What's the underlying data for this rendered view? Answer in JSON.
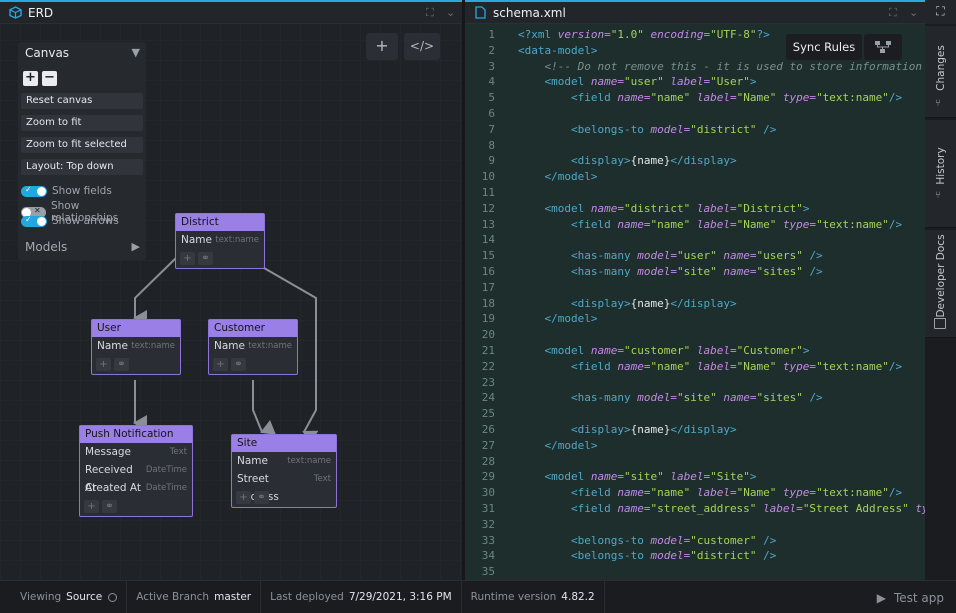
{
  "erd_tab": {
    "title": "ERD"
  },
  "code_tab": {
    "title": "schema.xml"
  },
  "canvas_panel": {
    "title": "Canvas",
    "zoom_in": "+",
    "zoom_out": "−",
    "buttons": [
      "Reset canvas",
      "Zoom to fit",
      "Zoom to fit selected",
      "Layout: Top down"
    ],
    "toggles": [
      {
        "label": "Show fields",
        "on": true
      },
      {
        "label": "Show relationships",
        "on": false
      },
      {
        "label": "Show arrows",
        "on": true
      }
    ],
    "models_label": "Models"
  },
  "nodes": {
    "district": {
      "title": "District",
      "fields": [
        {
          "name": "Name",
          "type": "text:name"
        }
      ]
    },
    "user": {
      "title": "User",
      "fields": [
        {
          "name": "Name",
          "type": "text:name"
        }
      ]
    },
    "customer": {
      "title": "Customer",
      "fields": [
        {
          "name": "Name",
          "type": "text:name"
        }
      ]
    },
    "push": {
      "title": "Push Notification",
      "fields": [
        {
          "name": "Message",
          "type": "Text"
        },
        {
          "name": "Received At",
          "type": "DateTime"
        },
        {
          "name": "Created At",
          "type": "DateTime"
        }
      ]
    },
    "site": {
      "title": "Site",
      "fields": [
        {
          "name": "Name",
          "type": "text:name"
        },
        {
          "name": "Street Address",
          "type": "Text"
        }
      ]
    }
  },
  "code_toolbar": {
    "sync_rules": "Sync Rules"
  },
  "code_lines": [
    "1",
    "2",
    "3",
    "4",
    "5",
    "6",
    "7",
    "8",
    "9",
    "10",
    "11",
    "12",
    "13",
    "14",
    "15",
    "16",
    "17",
    "18",
    "19",
    "20",
    "21",
    "22",
    "23",
    "24",
    "25",
    "26",
    "27",
    "28",
    "29",
    "30",
    "31",
    "32",
    "33",
    "34",
    "35"
  ],
  "code": {
    "l1": "<?xml version=\"1.0\" encoding=\"UTF-8\"?>",
    "l2": "<data-model>",
    "l3": "<!-- Do not remove this - it is used to store information ab",
    "l4_open": "<model",
    "l4_name": "name=",
    "l4_name_v": "\"user\"",
    "l4_label": "label=",
    "l4_label_v": "\"User\"",
    "l4_close": ">",
    "sync_rules": "Sync Rules"
  },
  "rail": {
    "changes": "Changes",
    "history": "History",
    "developer_docs": "Developer Docs"
  },
  "status": {
    "viewing_label": "Viewing",
    "viewing_value": "Source",
    "branch_label": "Active Branch",
    "branch_value": "master",
    "deployed_label": "Last deployed",
    "deployed_value": "7/29/2021, 3:16 PM",
    "runtime_label": "Runtime version",
    "runtime_value": "4.82.2",
    "test_app": "Test app"
  }
}
